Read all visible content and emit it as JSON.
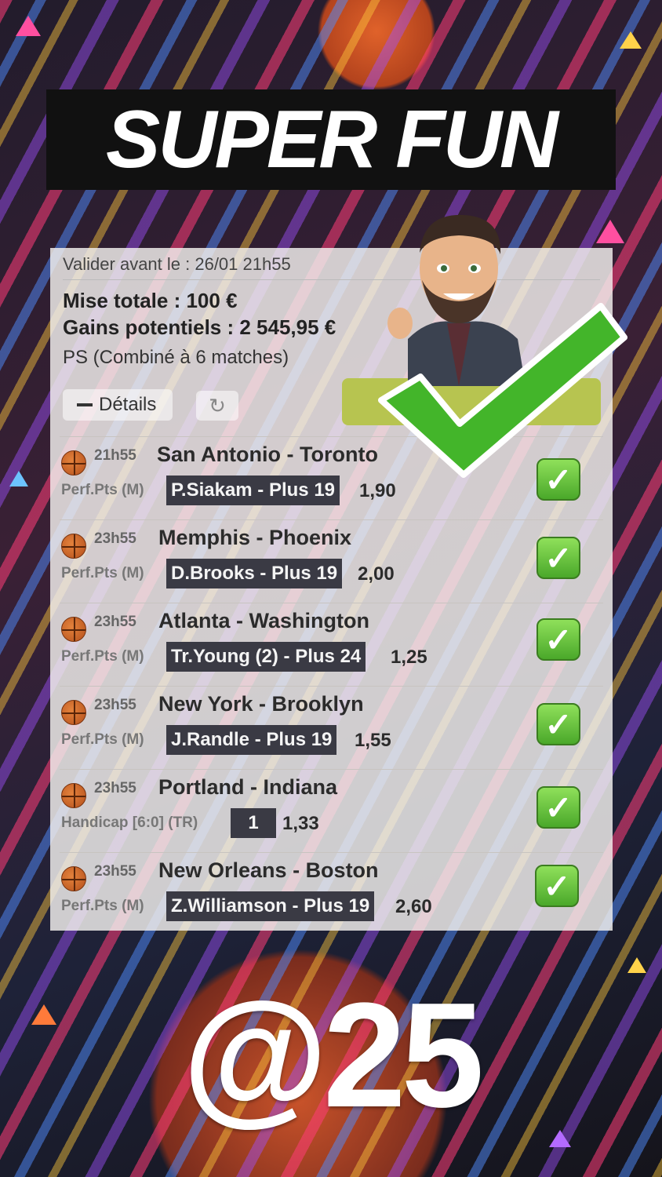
{
  "header": {
    "title": "SUPER FUN"
  },
  "ticket": {
    "deadline": "Valider avant le : 26/01 21h55",
    "stake": "Mise totale : 100 €",
    "potential_gains": "Gains potentiels : 2 545,95 €",
    "bet_type": "PS (Combiné à 6 matches)",
    "details_label": "Détails"
  },
  "bets": [
    {
      "time": "21h55",
      "match": "San Antonio - Toronto",
      "market": "Perf.Pts (M)",
      "pick": "P.Siakam - Plus 19",
      "odds": "1,90",
      "status": "check-icon"
    },
    {
      "time": "23h55",
      "match": "Memphis - Phoenix",
      "market": "Perf.Pts (M)",
      "pick": "D.Brooks - Plus 19",
      "odds": "2,00",
      "status": "check-icon"
    },
    {
      "time": "23h55",
      "match": "Atlanta - Washington",
      "market": "Perf.Pts (M)",
      "pick": "Tr.Young (2) - Plus 24",
      "odds": "1,25",
      "status": "check-icon"
    },
    {
      "time": "23h55",
      "match": "New York - Brooklyn",
      "market": "Perf.Pts (M)",
      "pick": "J.Randle - Plus 19",
      "odds": "1,55",
      "status": "check-icon"
    },
    {
      "time": "23h55",
      "match": "Portland - Indiana",
      "market": "Handicap [6:0] (TR)",
      "pick": "1",
      "odds": "1,33",
      "status": "check-icon"
    },
    {
      "time": "23h55",
      "match": "New Orleans - Boston",
      "market": "Perf.Pts (M)",
      "pick": "Z.Williamson - Plus 19",
      "odds": "2,60",
      "status": "check-icon"
    }
  ],
  "footer": {
    "total_odds": "@25"
  },
  "colors": {
    "check_green": "#4aa82a",
    "pick_bg": "#3a3a44",
    "title_bg": "#111111"
  }
}
